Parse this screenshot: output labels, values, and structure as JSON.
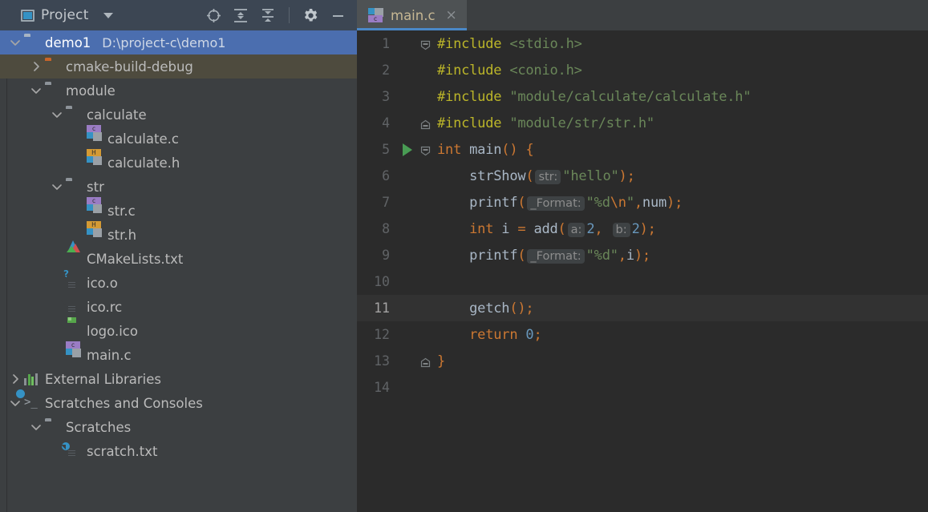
{
  "sidebar": {
    "header": {
      "icon": "project-window-icon",
      "title": "Project",
      "caret": "chevron-down-icon",
      "actions": [
        {
          "name": "select-opened-file-icon",
          "glyph": "crosshair"
        },
        {
          "name": "expand-all-icon",
          "glyph": "expand"
        },
        {
          "name": "collapse-all-icon",
          "glyph": "collapse"
        },
        {
          "name": "settings-gear-icon",
          "glyph": "gear"
        },
        {
          "name": "hide-panel-icon",
          "glyph": "minus"
        }
      ]
    },
    "tree": [
      {
        "label": "demo1",
        "path": "D:\\project-c\\demo1",
        "icon": "folder-light",
        "twisty": "down",
        "indent": 0,
        "state": "selected"
      },
      {
        "label": "cmake-build-debug",
        "path": "",
        "icon": "folder-orange",
        "twisty": "right",
        "indent": 1,
        "state": "excluded"
      },
      {
        "label": "module",
        "path": "",
        "icon": "folder",
        "twisty": "down",
        "indent": 1,
        "state": ""
      },
      {
        "label": "calculate",
        "path": "",
        "icon": "folder",
        "twisty": "down",
        "indent": 2,
        "state": ""
      },
      {
        "label": "calculate.c",
        "path": "",
        "icon": "c-file",
        "twisty": "none",
        "indent": 3,
        "state": ""
      },
      {
        "label": "calculate.h",
        "path": "",
        "icon": "h-file",
        "twisty": "none",
        "indent": 3,
        "state": ""
      },
      {
        "label": "str",
        "path": "",
        "icon": "folder",
        "twisty": "down",
        "indent": 2,
        "state": ""
      },
      {
        "label": "str.c",
        "path": "",
        "icon": "c-file",
        "twisty": "none",
        "indent": 3,
        "state": ""
      },
      {
        "label": "str.h",
        "path": "",
        "icon": "h-file",
        "twisty": "none",
        "indent": 3,
        "state": ""
      },
      {
        "label": "CMakeLists.txt",
        "path": "",
        "icon": "cmake-file",
        "twisty": "none",
        "indent": 2,
        "state": ""
      },
      {
        "label": "ico.o",
        "path": "",
        "icon": "unknown-file",
        "twisty": "none",
        "indent": 2,
        "state": ""
      },
      {
        "label": "ico.rc",
        "path": "",
        "icon": "text-file",
        "twisty": "none",
        "indent": 2,
        "state": ""
      },
      {
        "label": "logo.ico",
        "path": "",
        "icon": "image-file",
        "twisty": "none",
        "indent": 2,
        "state": ""
      },
      {
        "label": "main.c",
        "path": "",
        "icon": "c-file",
        "twisty": "none",
        "indent": 2,
        "state": ""
      },
      {
        "label": "External Libraries",
        "path": "",
        "icon": "libraries",
        "twisty": "right",
        "indent": 0,
        "state": ""
      },
      {
        "label": "Scratches and Consoles",
        "path": "",
        "icon": "scratches",
        "twisty": "down",
        "indent": 0,
        "state": ""
      },
      {
        "label": "Scratches",
        "path": "",
        "icon": "folder",
        "twisty": "down",
        "indent": 1,
        "state": ""
      },
      {
        "label": "scratch.txt",
        "path": "",
        "icon": "scratch-file",
        "twisty": "none",
        "indent": 2,
        "state": ""
      }
    ]
  },
  "editor": {
    "tabs": [
      {
        "label": "main.c",
        "icon": "c-file",
        "close": "×",
        "active": true
      }
    ],
    "current_line": 11,
    "run_marker_line": 5,
    "lines": [
      {
        "n": "1",
        "fold": "start",
        "tokens": [
          {
            "t": "#include ",
            "c": "s-pre"
          },
          {
            "t": "<stdio.h>",
            "c": "s-str"
          }
        ]
      },
      {
        "n": "2",
        "fold": "bar",
        "tokens": [
          {
            "t": "#include ",
            "c": "s-pre"
          },
          {
            "t": "<conio.h>",
            "c": "s-str"
          }
        ]
      },
      {
        "n": "3",
        "fold": "bar",
        "tokens": [
          {
            "t": "#include ",
            "c": "s-pre"
          },
          {
            "t": "\"module/calculate/calculate.h\"",
            "c": "s-str"
          }
        ]
      },
      {
        "n": "4",
        "fold": "end",
        "tokens": [
          {
            "t": "#include ",
            "c": "s-pre"
          },
          {
            "t": "\"module/str/str.h\"",
            "c": "s-str"
          }
        ]
      },
      {
        "n": "5",
        "fold": "start",
        "tokens": [
          {
            "t": "int ",
            "c": "s-kw"
          },
          {
            "t": "main",
            "c": "s-fn"
          },
          {
            "t": "() {",
            "c": "s-punc"
          }
        ]
      },
      {
        "n": "6",
        "fold": "bar",
        "tokens": [
          {
            "t": "    strShow",
            "c": "s-fn"
          },
          {
            "t": "(",
            "c": "s-punc"
          },
          {
            "t": "str:",
            "c": "chip"
          },
          {
            "t": "\"hello\"",
            "c": "s-str"
          },
          {
            "t": ");",
            "c": "s-punc"
          }
        ]
      },
      {
        "n": "7",
        "fold": "bar",
        "tokens": [
          {
            "t": "    printf",
            "c": "s-fn"
          },
          {
            "t": "(",
            "c": "s-punc"
          },
          {
            "t": "_Format:",
            "c": "chip"
          },
          {
            "t": "\"%d",
            "c": "s-str"
          },
          {
            "t": "\\n",
            "c": "s-esc"
          },
          {
            "t": "\"",
            "c": "s-str"
          },
          {
            "t": ",",
            "c": "s-punc"
          },
          {
            "t": "num",
            "c": "s-plain"
          },
          {
            "t": ");",
            "c": "s-punc"
          }
        ]
      },
      {
        "n": "8",
        "fold": "bar",
        "tokens": [
          {
            "t": "    int ",
            "c": "s-kw"
          },
          {
            "t": "i ",
            "c": "s-plain"
          },
          {
            "t": "= ",
            "c": "s-punc"
          },
          {
            "t": "add",
            "c": "s-fn"
          },
          {
            "t": "(",
            "c": "s-punc"
          },
          {
            "t": "a:",
            "c": "chip"
          },
          {
            "t": "2",
            "c": "s-num"
          },
          {
            "t": ", ",
            "c": "s-punc"
          },
          {
            "t": "b:",
            "c": "chip"
          },
          {
            "t": "2",
            "c": "s-num"
          },
          {
            "t": ");",
            "c": "s-punc"
          }
        ]
      },
      {
        "n": "9",
        "fold": "bar",
        "tokens": [
          {
            "t": "    printf",
            "c": "s-fn"
          },
          {
            "t": "(",
            "c": "s-punc"
          },
          {
            "t": "_Format:",
            "c": "chip"
          },
          {
            "t": "\"%d\"",
            "c": "s-str"
          },
          {
            "t": ",",
            "c": "s-punc"
          },
          {
            "t": "i",
            "c": "s-plain"
          },
          {
            "t": ");",
            "c": "s-punc"
          }
        ]
      },
      {
        "n": "10",
        "fold": "bar",
        "tokens": []
      },
      {
        "n": "11",
        "fold": "bar",
        "tokens": [
          {
            "t": "    getch",
            "c": "s-fn"
          },
          {
            "t": "();",
            "c": "s-punc"
          }
        ]
      },
      {
        "n": "12",
        "fold": "bar",
        "tokens": [
          {
            "t": "    return ",
            "c": "s-kw"
          },
          {
            "t": "0",
            "c": "s-num"
          },
          {
            "t": ";",
            "c": "s-punc"
          }
        ]
      },
      {
        "n": "13",
        "fold": "end",
        "tokens": [
          {
            "t": "}",
            "c": "s-punc"
          }
        ]
      },
      {
        "n": "14",
        "fold": "none",
        "tokens": []
      }
    ]
  },
  "colors": {
    "sidebar_bg": "#3c3f41",
    "editor_bg": "#2b2b2b",
    "toolbar_bg": "#3c4653",
    "selection_blue": "#4b6eaf",
    "excluded_olive": "#4e4b3e",
    "tab_underline": "#4a88c7",
    "run_green": "#499c54",
    "keyword_orange": "#cc7832",
    "string_green": "#6a8759",
    "preproc_yellow": "#bbb529",
    "number_blue": "#6897bb"
  }
}
